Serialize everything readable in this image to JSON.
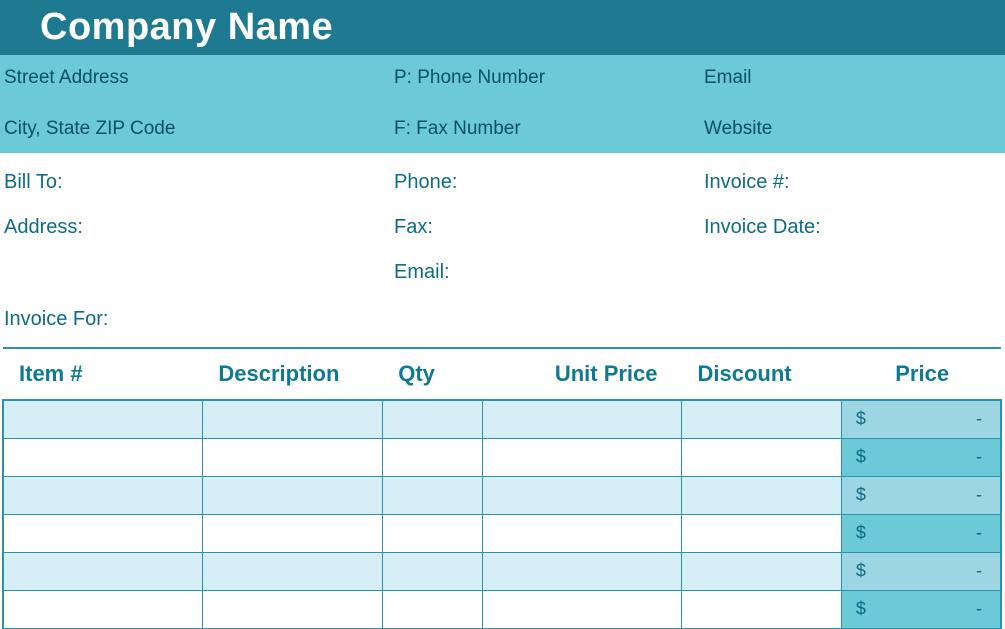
{
  "header": {
    "company_name": "Company Name"
  },
  "company_info": {
    "street": "Street Address",
    "city_state_zip": "City, State ZIP Code",
    "phone": "P: Phone Number",
    "fax": "F: Fax Number",
    "email": "Email",
    "website": "Website"
  },
  "bill": {
    "bill_to": "Bill To:",
    "address": "Address:",
    "phone": "Phone:",
    "fax": "Fax:",
    "email": "Email:",
    "invoice_num": "Invoice #:",
    "invoice_date": "Invoice Date:"
  },
  "invoice_for": "Invoice For:",
  "table": {
    "headers": {
      "item": "Item #",
      "description": "Description",
      "qty": "Qty",
      "unit_price": "Unit Price",
      "discount": "Discount",
      "price": "Price"
    },
    "rows": [
      {
        "item": "",
        "description": "",
        "qty": "",
        "unit_price": "",
        "discount": "",
        "currency": "$",
        "price": "-"
      },
      {
        "item": "",
        "description": "",
        "qty": "",
        "unit_price": "",
        "discount": "",
        "currency": "$",
        "price": "-"
      },
      {
        "item": "",
        "description": "",
        "qty": "",
        "unit_price": "",
        "discount": "",
        "currency": "$",
        "price": "-"
      },
      {
        "item": "",
        "description": "",
        "qty": "",
        "unit_price": "",
        "discount": "",
        "currency": "$",
        "price": "-"
      },
      {
        "item": "",
        "description": "",
        "qty": "",
        "unit_price": "",
        "discount": "",
        "currency": "$",
        "price": "-"
      },
      {
        "item": "",
        "description": "",
        "qty": "",
        "unit_price": "",
        "discount": "",
        "currency": "$",
        "price": "-"
      }
    ]
  },
  "colors": {
    "title_bg": "#1d7a90",
    "info_bg": "#6bc9d8",
    "band_light": "#d6eef6",
    "price_light": "#9dd6e3",
    "price_mid": "#6bc9d8",
    "text": "#0e6b87",
    "border": "#2a93a9"
  }
}
